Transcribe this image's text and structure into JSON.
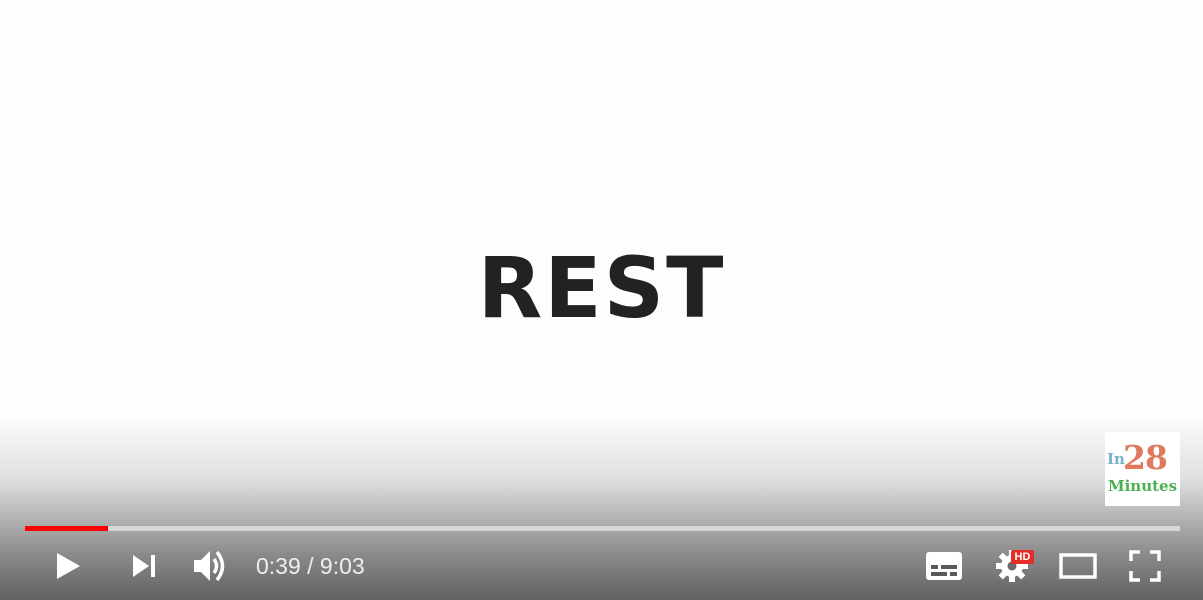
{
  "video": {
    "slide_text": "REST"
  },
  "watermark": {
    "prefix": "In",
    "number": "28",
    "word": "Minutes"
  },
  "progress": {
    "played_fraction": 0.072,
    "played_color": "#ff0000"
  },
  "controls": {
    "current_time": "0:39",
    "separator": "/",
    "duration": "9:03",
    "time_display": "0:39 / 9:03",
    "quality_badge": "HD",
    "icons": [
      "play-icon",
      "next-icon",
      "volume-icon",
      "subtitles-icon",
      "settings-icon",
      "theater-mode-icon",
      "fullscreen-icon"
    ]
  }
}
